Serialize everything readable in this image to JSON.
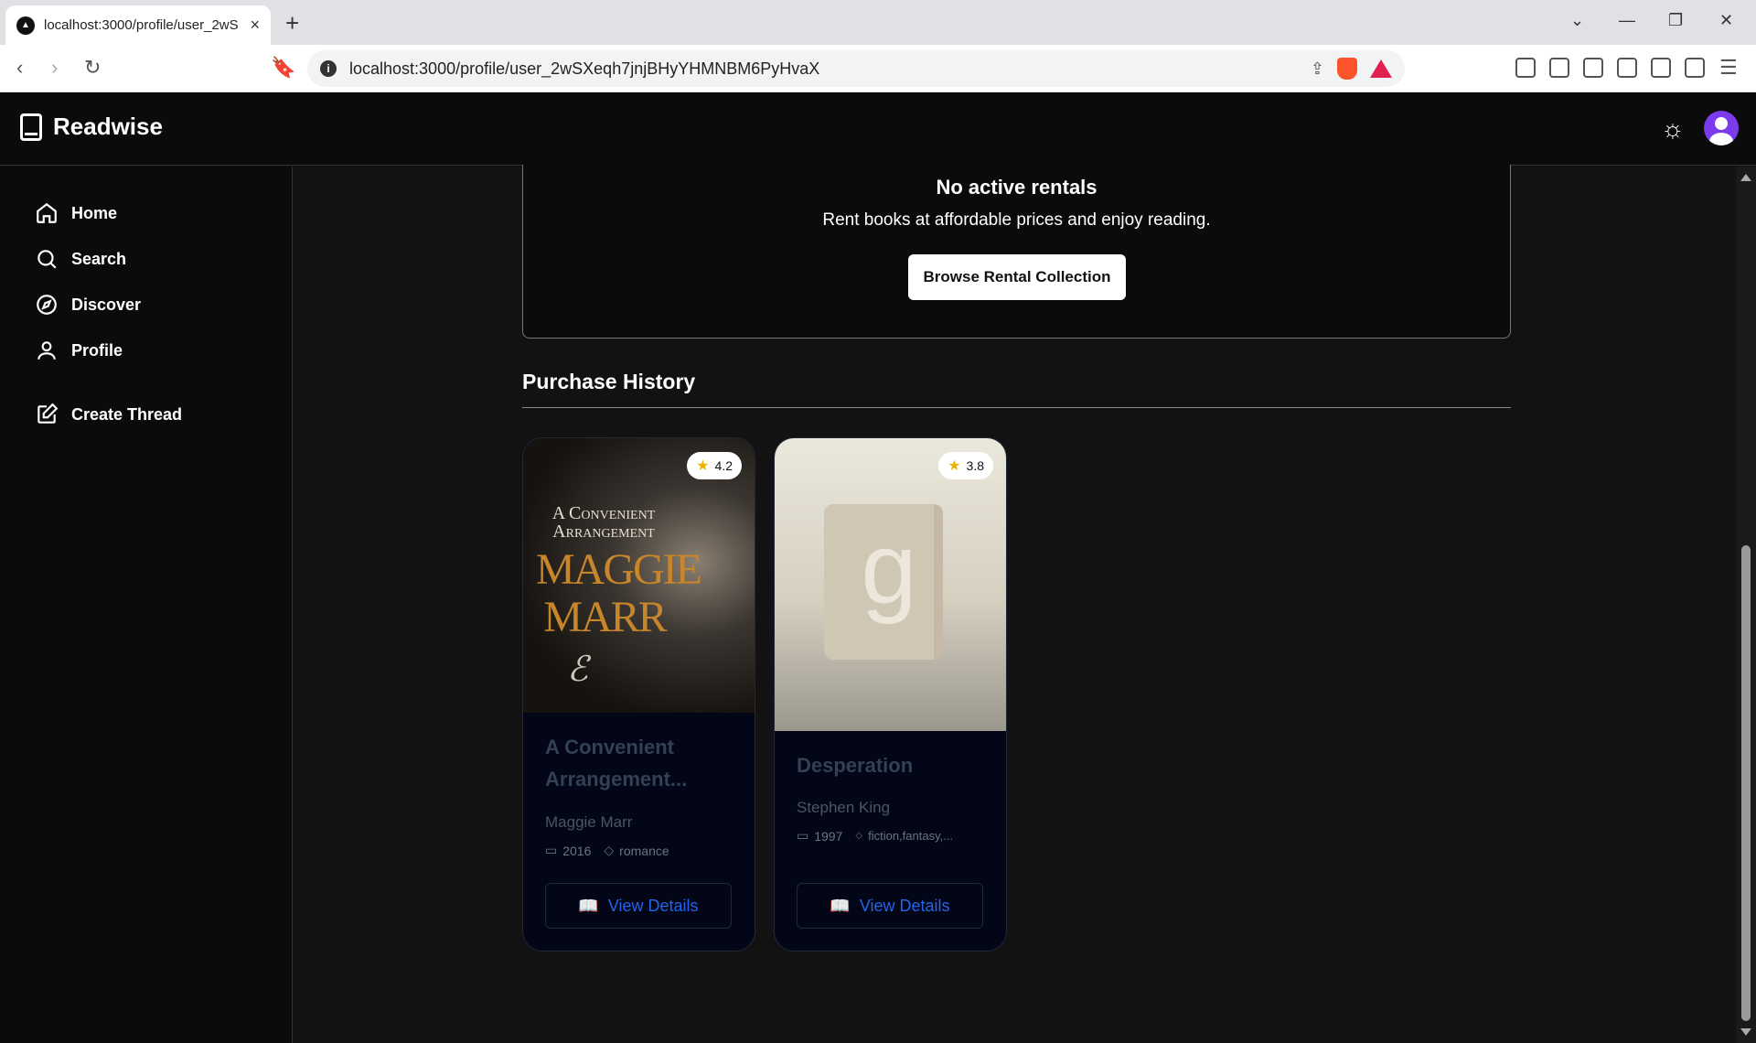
{
  "browser": {
    "tab_title": "localhost:3000/profile/user_2wS",
    "tab_close": "×",
    "new_tab": "+",
    "url_host": "localhost",
    "url_path": ":3000/profile/user_2wSXeqh7jnjBHyYHMNBM6PyHvaX"
  },
  "header": {
    "brand": "Readwise"
  },
  "sidebar": {
    "items": [
      {
        "label": "Home",
        "icon": "home-icon"
      },
      {
        "label": "Search",
        "icon": "search-icon"
      },
      {
        "label": "Discover",
        "icon": "compass-icon"
      },
      {
        "label": "Profile",
        "icon": "user-icon"
      },
      {
        "label": "Create Thread",
        "icon": "edit-icon"
      }
    ]
  },
  "rentals": {
    "title": "No active rentals",
    "subtitle": "Rent books at affordable prices and enjoy reading.",
    "button": "Browse Rental Collection"
  },
  "purchase_history": {
    "title": "Purchase History",
    "books": [
      {
        "rating": "4.2",
        "cover_text_top": "A Convenient Arrangement",
        "cover_text_author": "MAGGIE MARR",
        "title": "A Convenient Arrangement...",
        "author": "Maggie Marr",
        "year": "2016",
        "tags": "romance",
        "button": "View Details"
      },
      {
        "rating": "3.8",
        "cover_placeholder": "g",
        "title": "Desperation",
        "author": "Stephen King",
        "year": "1997",
        "tags": "fiction,fantasy,...",
        "button": "View Details"
      }
    ]
  },
  "colors": {
    "accent": "#2563eb",
    "avatar": "#7c3aed",
    "star": "#eab308"
  }
}
